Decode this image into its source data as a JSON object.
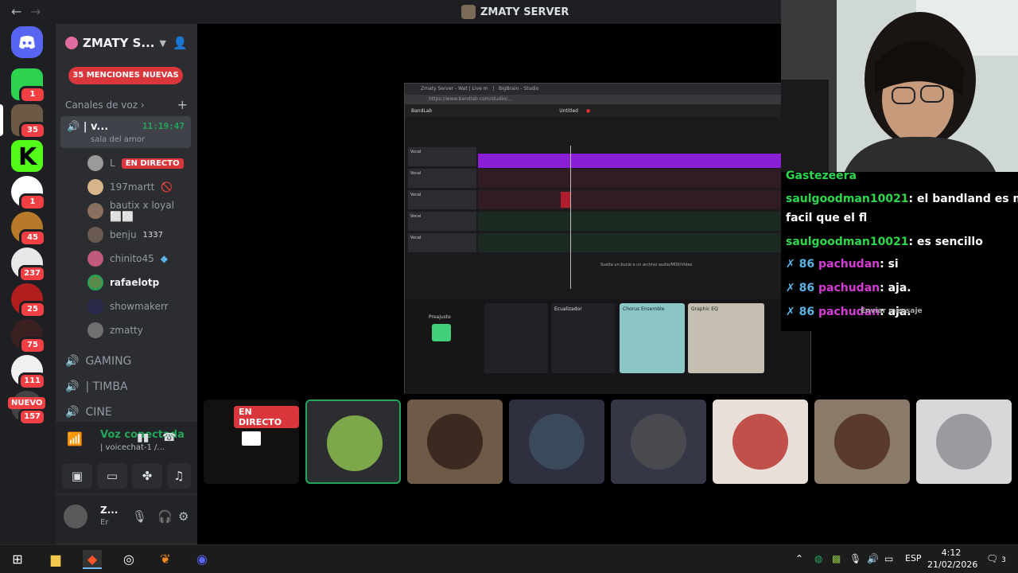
{
  "titlebar": {
    "back": "←",
    "forward": "→",
    "title": "ZMATY SERVER"
  },
  "rail": {
    "badges": [
      "1",
      "35",
      "1",
      "45",
      "237",
      "25",
      "75",
      "111",
      "157"
    ],
    "nuevo": "NUEVO"
  },
  "server": {
    "name": "ZMATY S...",
    "mentions": "35 MENCIONES NUEVAS",
    "category": "Canales de voz",
    "active_channel": {
      "name": "| v...",
      "time": "11:19:47",
      "subtitle": "sala del amor"
    },
    "members": [
      {
        "name": "L",
        "live": "EN DIRECTO"
      },
      {
        "name": "197martt"
      },
      {
        "name": "bautix x loyal ⬜⬜"
      },
      {
        "name": "benju",
        "extra": "1337"
      },
      {
        "name": "chinito45"
      },
      {
        "name": "rafaelotp"
      },
      {
        "name": "showmakerr"
      },
      {
        "name": "zmatty"
      }
    ],
    "channels": [
      "GAMING",
      "| TIMBA",
      "CINE"
    ]
  },
  "voice": {
    "status": "Voz conectada",
    "sub": "| voicechat-1 /..."
  },
  "user": {
    "name": "Z...",
    "status": "Er"
  },
  "screenshare": {
    "tab1": "Zmaty Server - Wat | Live m",
    "tab2": "BigBrain - Studio",
    "url": "https://www.bandlab.com/studio/...",
    "app": "BandLab",
    "hint": "Suelta un bucle o un archivo audio/MIDI/Vídeo",
    "fx_preset": "Preajuste",
    "fx1": "Ecualizador",
    "fx2": "Chorus Ensemble",
    "fx3": "Graphic EQ",
    "project": "Untitled"
  },
  "chat": [
    {
      "user": "Gastezeera",
      "msg": ""
    },
    {
      "user": "saulgoodman10021",
      "msg": ": el bandland es mas"
    },
    {
      "user": "",
      "msg": "facil que el fl"
    },
    {
      "user": "saulgoodman10021",
      "msg": ": es sencillo"
    },
    {
      "user": "pachudan",
      "msg": ": si"
    },
    {
      "user": "pachudan",
      "msg": ": aja."
    },
    {
      "user": "pachudan",
      "msg": ": aja."
    }
  ],
  "overlay_chat": {
    "send": "Enviar mensaje",
    "aja": "aja.",
    "si": "si"
  },
  "tiles": {
    "live": "EN DIRECTO"
  },
  "taskbar": {
    "lang": "ESP",
    "time": "4:12",
    "date": "21/02/2026",
    "notif": "3"
  }
}
